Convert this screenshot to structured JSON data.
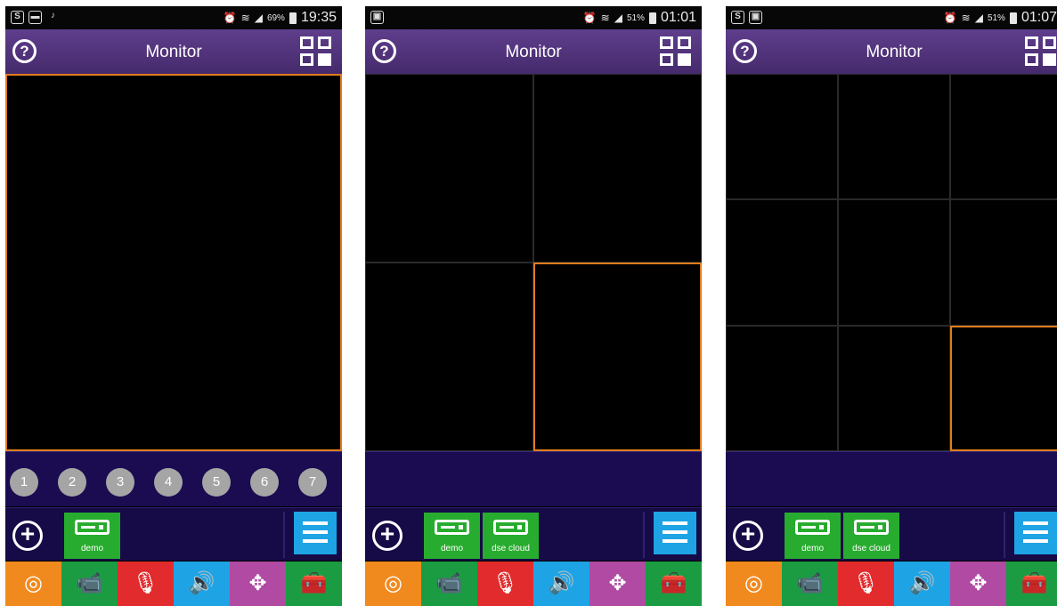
{
  "screens": [
    {
      "status": {
        "left_icons": [
          "S",
          "▬",
          "♪"
        ],
        "battery_pct": "69%",
        "time": "19:35"
      },
      "header": {
        "help_label": "?",
        "title": "Monitor"
      },
      "channels": [
        "1",
        "2",
        "3",
        "4",
        "5",
        "6",
        "7"
      ],
      "devices": [
        {
          "name": "demo"
        }
      ]
    },
    {
      "status": {
        "left_icons": [
          "▣"
        ],
        "battery_pct": "51%",
        "time": "01:01"
      },
      "header": {
        "help_label": "?",
        "title": "Monitor"
      },
      "channels": [],
      "devices": [
        {
          "name": "demo"
        },
        {
          "name": "dse cloud"
        }
      ]
    },
    {
      "status": {
        "left_icons": [
          "S",
          "▣"
        ],
        "battery_pct": "51%",
        "time": "01:07"
      },
      "header": {
        "help_label": "?",
        "title": "Monitor"
      },
      "channels": [],
      "devices": [
        {
          "name": "demo"
        },
        {
          "name": "dse cloud"
        }
      ]
    }
  ],
  "toolbar_icons": [
    {
      "name": "capture-icon",
      "glyph": "◎",
      "color": "#f18a1e"
    },
    {
      "name": "camera-icon",
      "glyph": "📹",
      "color": "#1b9c43"
    },
    {
      "name": "microphone-icon",
      "glyph": "🎙",
      "color": "#e22b2c"
    },
    {
      "name": "speaker-icon",
      "glyph": "🔊",
      "color": "#1ea4e5"
    },
    {
      "name": "ptz-arrows-icon",
      "glyph": "✥",
      "color": "#b04aa3"
    },
    {
      "name": "settings-case-icon",
      "glyph": "🧰",
      "color": "#1b9c43"
    }
  ]
}
